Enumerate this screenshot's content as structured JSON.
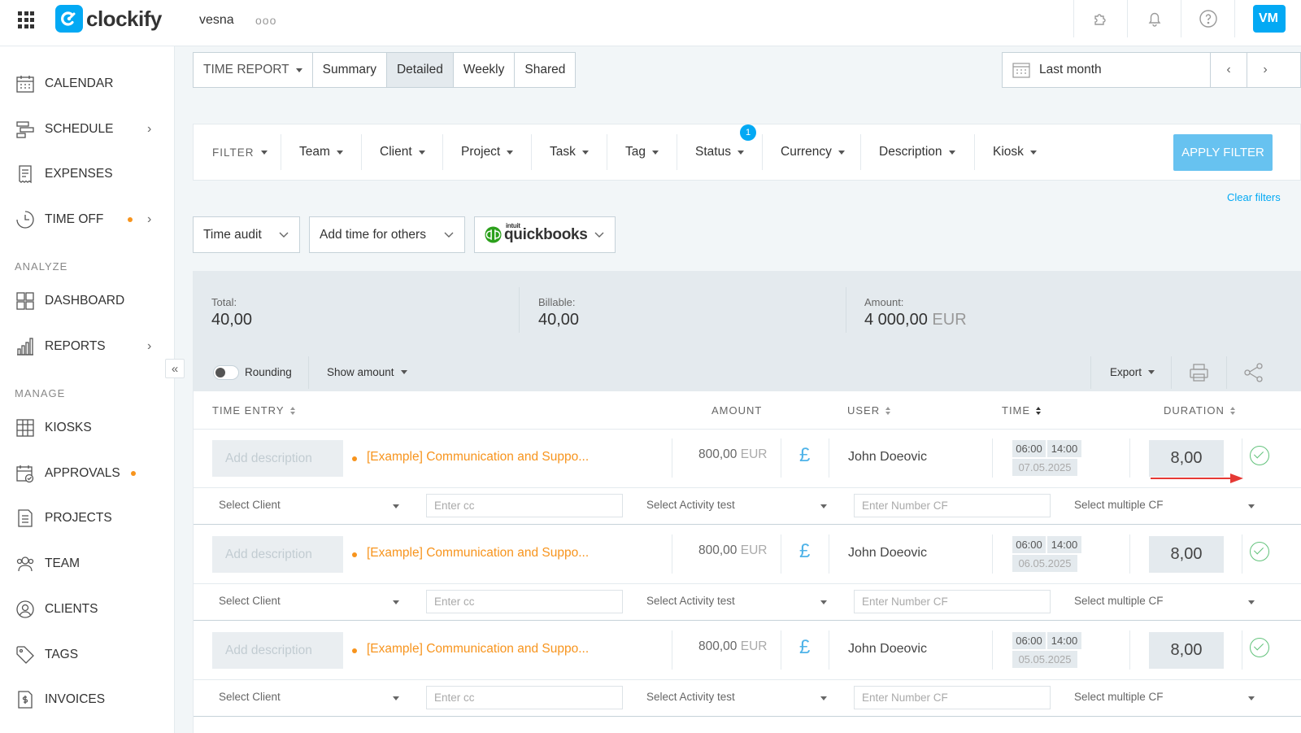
{
  "app": {
    "name": "clockify",
    "workspace": "vesna",
    "more": "ooo",
    "avatar_initials": "VM"
  },
  "colors": {
    "brand": "#03a9f4",
    "accent_orange": "#f7941d",
    "apply_button": "#67c2f0",
    "approved_green": "#62c27b",
    "annotation_red": "#e53935"
  },
  "top_icons": [
    "puzzle-icon",
    "bell-icon",
    "help-icon"
  ],
  "sidebar": {
    "items": [
      {
        "label": "CALENDAR",
        "icon": "calendar-icon"
      },
      {
        "label": "SCHEDULE",
        "icon": "schedule-icon",
        "chevron": true
      },
      {
        "label": "EXPENSES",
        "icon": "receipt-icon"
      },
      {
        "label": "TIME OFF",
        "icon": "clock-icon",
        "chevron": true,
        "dot": true
      }
    ],
    "analyze_label": "ANALYZE",
    "analyze_items": [
      {
        "label": "DASHBOARD",
        "icon": "dashboard-icon"
      },
      {
        "label": "REPORTS",
        "icon": "bar-chart-icon",
        "chevron": true
      }
    ],
    "manage_label": "MANAGE",
    "manage_items": [
      {
        "label": "KIOSKS",
        "icon": "kiosk-icon"
      },
      {
        "label": "APPROVALS",
        "icon": "approval-icon",
        "dot": true
      },
      {
        "label": "PROJECTS",
        "icon": "document-icon"
      },
      {
        "label": "TEAM",
        "icon": "team-icon"
      },
      {
        "label": "CLIENTS",
        "icon": "client-icon"
      },
      {
        "label": "TAGS",
        "icon": "tag-icon"
      },
      {
        "label": "INVOICES",
        "icon": "invoice-icon"
      }
    ],
    "collapse_glyph": "«"
  },
  "report_tabs": {
    "dropdown": "TIME REPORT",
    "tabs": [
      "Summary",
      "Detailed",
      "Weekly",
      "Shared"
    ],
    "active": "Detailed"
  },
  "date_range": {
    "label": "Last month",
    "prev": "‹",
    "next": "›"
  },
  "filters": {
    "label": "FILTER",
    "items": [
      "Team",
      "Client",
      "Project",
      "Task",
      "Tag",
      "Status",
      "Currency",
      "Description",
      "Kiosk"
    ],
    "status_badge": "1",
    "apply": "APPLY FILTER",
    "clear": "Clear filters"
  },
  "actions": {
    "time_audit": "Time audit",
    "add_time": "Add time for others",
    "quickbooks_small": "intuit",
    "quickbooks": "quickbooks"
  },
  "totals": {
    "total_label": "Total:",
    "total_value": "40,00",
    "billable_label": "Billable:",
    "billable_value": "40,00",
    "amount_label": "Amount:",
    "amount_value": "4 000,00",
    "amount_currency": "EUR"
  },
  "toolbar": {
    "rounding": "Rounding",
    "rounding_on": false,
    "show_amount": "Show amount",
    "export": "Export"
  },
  "table": {
    "headers": {
      "time_entry": "TIME ENTRY",
      "amount": "AMOUNT",
      "user": "USER",
      "time": "TIME",
      "duration": "DURATION"
    },
    "rows": [
      {
        "description_placeholder": "Add description",
        "project": "[Example] Communication and Suppo...",
        "amount": "800,00",
        "currency": "EUR",
        "currency_symbol": "£",
        "user": "John Doeovic",
        "start": "06:00",
        "end": "14:00",
        "date": "07.05.2025",
        "duration": "8,00"
      },
      {
        "description_placeholder": "Add description",
        "project": "[Example] Communication and Suppo...",
        "amount": "800,00",
        "currency": "EUR",
        "currency_symbol": "£",
        "user": "John Doeovic",
        "start": "06:00",
        "end": "14:00",
        "date": "06.05.2025",
        "duration": "8,00"
      },
      {
        "description_placeholder": "Add description",
        "project": "[Example] Communication and Suppo...",
        "amount": "800,00",
        "currency": "EUR",
        "currency_symbol": "£",
        "user": "John Doeovic",
        "start": "06:00",
        "end": "14:00",
        "date": "05.05.2025",
        "duration": "8,00"
      }
    ],
    "custom_fields": {
      "select_client": "Select Client",
      "enter_cc": "Enter cc",
      "select_activity": "Select Activity test",
      "enter_number": "Enter Number CF",
      "select_multiple": "Select multiple CF"
    }
  }
}
